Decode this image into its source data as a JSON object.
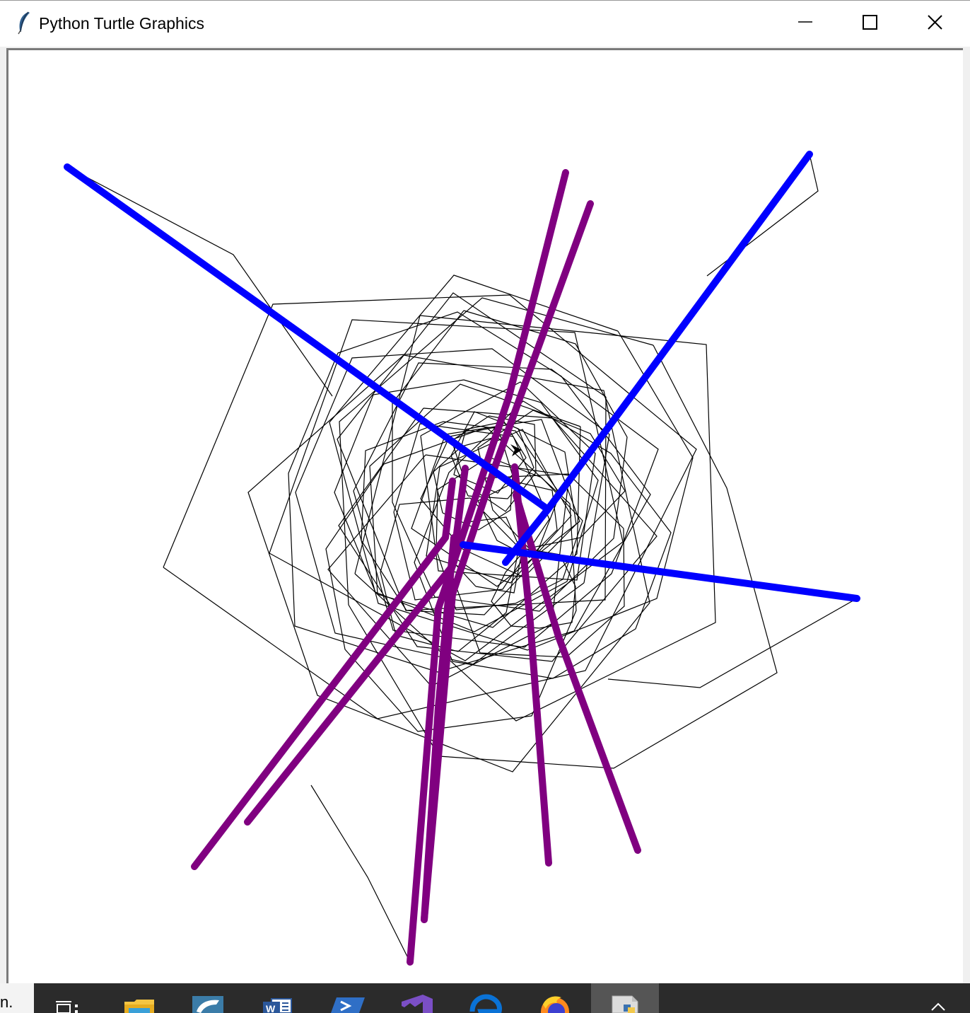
{
  "window": {
    "title": "Python Turtle Graphics",
    "controls": [
      "minimize",
      "maximize",
      "close"
    ]
  },
  "canvas": {
    "background": "#ffffff",
    "pen_colors": {
      "thin": "#000000",
      "blue": "#0000ff",
      "purple": "#800080"
    }
  },
  "taskbar": {
    "left_glyph": "n.",
    "apps": [
      {
        "name": "task-view",
        "icon": "task-view-icon"
      },
      {
        "name": "file-explorer",
        "icon": "folder-icon"
      },
      {
        "name": "mysql-workbench",
        "icon": "dolphin-icon"
      },
      {
        "name": "microsoft-word",
        "icon": "word-icon"
      },
      {
        "name": "powershell",
        "icon": "powershell-icon"
      },
      {
        "name": "visual-studio",
        "icon": "visual-studio-icon"
      },
      {
        "name": "microsoft-edge",
        "icon": "edge-icon"
      },
      {
        "name": "firefox",
        "icon": "firefox-icon"
      },
      {
        "name": "python-turtle",
        "icon": "python-file-icon",
        "active": true
      }
    ],
    "tray": {
      "icon": "chevron-up-icon"
    }
  }
}
